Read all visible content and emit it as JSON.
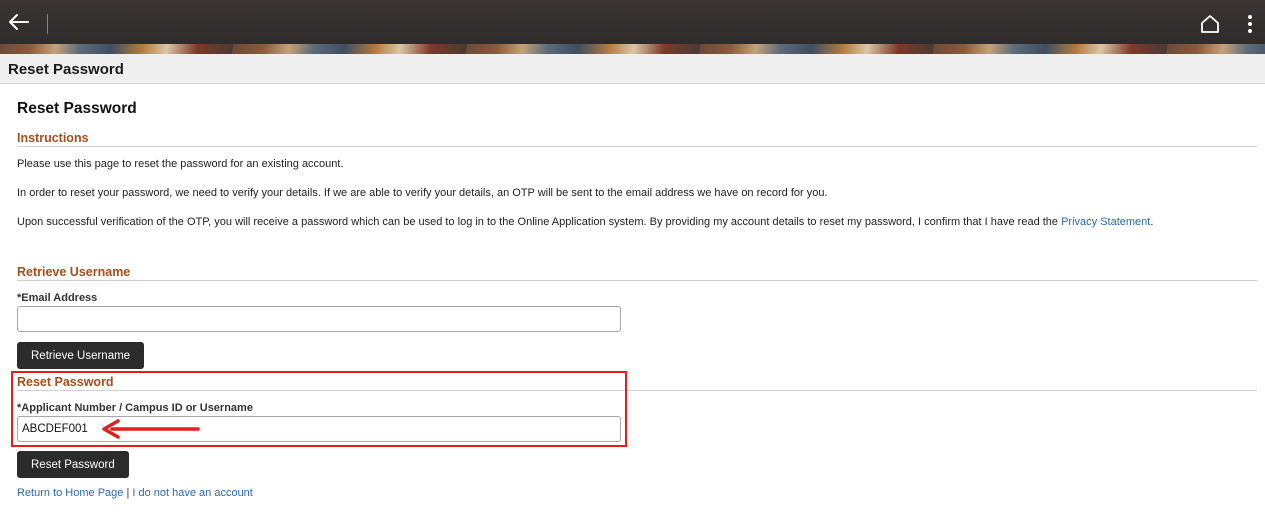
{
  "header": {
    "page_title": "Reset Password"
  },
  "main": {
    "title": "Reset Password",
    "instructions": {
      "heading": "Instructions",
      "para1": "Please use this page to reset the password for an existing account.",
      "para2": "In order to reset your password, we need to verify your details. If we are able to verify your details, an OTP will be sent to the email address we have on record for you.",
      "para3_text": "Upon successful verification of the OTP, you will receive a password which can be used to log in to the Online Application system. By providing my account details to reset my password, I confirm that I have read the ",
      "para3_link": "Privacy Statement",
      "para3_end": "."
    },
    "retrieve": {
      "heading": "Retrieve Username",
      "email_label": "*Email Address",
      "email_value": "",
      "button_label": "Retrieve Username"
    },
    "reset": {
      "heading": "Reset Password",
      "id_label": "*Applicant Number / Campus ID or Username",
      "id_value": "ABCDEF001",
      "button_label": "Reset Password"
    },
    "footer": {
      "home_link": "Return to Home Page",
      "separator": "|",
      "no_account_link": "I do not have an account"
    }
  },
  "icons": {
    "back": "arrow-left-icon",
    "home": "home-icon",
    "more": "more-vertical-icon"
  },
  "colors": {
    "section_heading": "#a34f1e",
    "link": "#2a6bb0",
    "button": "#2b2b2b",
    "annotation": "#e02020"
  }
}
